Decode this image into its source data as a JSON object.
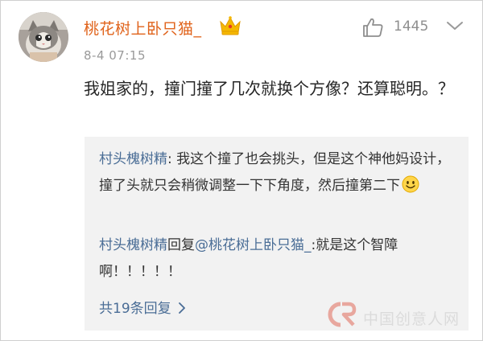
{
  "comment": {
    "username": "桃花树上卧只猫_",
    "timestamp": "8-4 07:15",
    "like_count": "1445",
    "text": "我姐家的，撞门撞了几次就换个方像？还算聪明。？",
    "icons": [
      "avatar",
      "crown-icon",
      "thumbs-up-icon",
      "chevron-down-icon"
    ]
  },
  "replies": {
    "items": [
      {
        "author": "村头槐树精",
        "separator": ": ",
        "text": "我这个撞了也会挑头，但是这个神他妈设计，撞了头就只会稍微调整一下下角度，然后撞第二下",
        "icon": "smiley-emoji-icon"
      },
      {
        "author": "村头槐树精",
        "reply_word": "回复",
        "mention": "@桃花树上卧只猫_",
        "separator": ":",
        "text": "就是这个智障啊！！！！！"
      }
    ],
    "more_label": "共19条回复"
  },
  "watermark": {
    "text": "中国创意人网"
  },
  "colors": {
    "username": "#e0631b",
    "link": "#4a6d96",
    "timestamp": "#9a9a9a",
    "reply_bg": "#f2f2f2",
    "crown": "#f5b800"
  }
}
